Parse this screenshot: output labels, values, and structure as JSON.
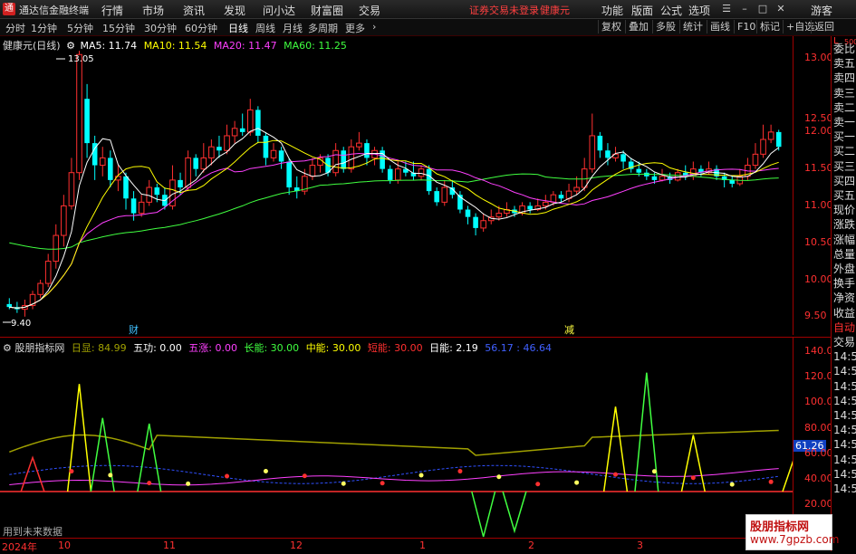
{
  "titlebar": {
    "logo": "通",
    "app_name": "通达信金融终端",
    "menus": [
      "行情",
      "市场",
      "资讯",
      "发现",
      "问小达",
      "财富圈",
      "交易"
    ],
    "warning": "证券交易未登录",
    "stock": "健康元",
    "right_menus": [
      "功能",
      "版面",
      "公式",
      "选项"
    ],
    "guest": "游客"
  },
  "toolbar": {
    "periods": [
      "分时",
      "1分钟",
      "5分钟",
      "15分钟",
      "30分钟",
      "60分钟",
      "日线",
      "周线",
      "月线",
      "多周期",
      "更多"
    ],
    "active_period": "日线",
    "right_buttons": [
      "复权",
      "叠加",
      "多股",
      "统计",
      "画线",
      "F10",
      "标记",
      "+自选",
      "返回"
    ]
  },
  "legend": {
    "title": "健康元(日线)",
    "ma": [
      {
        "label": "MA5: 11.74",
        "color": "#ffffff"
      },
      {
        "label": "MA10: 11.54",
        "color": "#ffff00"
      },
      {
        "label": "MA20: 11.47",
        "color": "#ff40ff"
      },
      {
        "label": "MA60: 11.25",
        "color": "#40ff40"
      }
    ]
  },
  "price_axis": {
    "ticks": [
      "13.00",
      "12.50",
      "12.00",
      "11.50",
      "11.00",
      "10.50",
      "10.00",
      "9.50"
    ],
    "high_label": "13.05",
    "low_label": "9.40"
  },
  "markers": {
    "cai": "财",
    "jian": "减"
  },
  "indicator_legend": {
    "name": "股朋指标网",
    "items": [
      {
        "label": "日显: 84.99",
        "color": "#a0a000"
      },
      {
        "label": "五功: 0.00",
        "color": "#ffffff"
      },
      {
        "label": "五涨: 0.00",
        "color": "#ff40ff"
      },
      {
        "label": "长能: 30.00",
        "color": "#40ff40"
      },
      {
        "label": "中能: 30.00",
        "color": "#ffff00"
      },
      {
        "label": "短能: 30.00",
        "color": "#ff3030"
      },
      {
        "label": "日能: 2.19",
        "color": "#ffffff"
      },
      {
        "label": "56.17 : 46.64",
        "color": "#4060ff"
      }
    ]
  },
  "indicator_axis": {
    "ticks": [
      "140.00",
      "120.00",
      "100.00",
      "80.00",
      "60.00",
      "40.00",
      "20.00"
    ],
    "current": "61.26"
  },
  "indicator_note": "用到未来数据",
  "x_axis": {
    "labels": [
      "2024年",
      "10",
      "11",
      "12",
      "1",
      "2",
      "3"
    ]
  },
  "right_panel": [
    "L",
    "500",
    "委比",
    "卖五",
    "卖四",
    "卖三",
    "卖二",
    "卖一",
    "买一",
    "买二",
    "买三",
    "买四",
    "买五",
    "现价",
    "涨跌",
    "涨幅",
    "总量",
    "外盘",
    "换手",
    "净资",
    "收益",
    "自动",
    "交易",
    "14:56",
    "14:56",
    "14:56",
    "14:56",
    "14:56",
    "14:56",
    "14:56",
    "14:56",
    "14:56",
    "14:56"
  ],
  "watermark": {
    "line1": "股朋指标网",
    "line2": "www.7gpzb.com"
  },
  "colors": {
    "up": "#ff3030",
    "down": "#00ffff",
    "ma5": "#ffffff",
    "ma10": "#ffff00",
    "ma20": "#ff40ff",
    "ma60": "#40ff40",
    "axis": "#a00000"
  },
  "chart_data": {
    "type": "candlestick",
    "ylim": [
      9.3,
      13.15
    ],
    "candles": [
      [
        9.62,
        9.58,
        9.7,
        9.55
      ],
      [
        9.58,
        9.55,
        9.65,
        9.5
      ],
      [
        9.55,
        9.6,
        9.68,
        9.45
      ],
      [
        9.6,
        9.75,
        9.8,
        9.55
      ],
      [
        9.75,
        9.9,
        9.95,
        9.7
      ],
      [
        9.9,
        10.2,
        10.3,
        9.85
      ],
      [
        10.2,
        10.55,
        10.7,
        10.1
      ],
      [
        10.55,
        10.95,
        11.1,
        10.4
      ],
      [
        10.95,
        11.4,
        11.6,
        10.9
      ],
      [
        11.4,
        13.0,
        13.05,
        11.3
      ],
      [
        12.4,
        11.8,
        12.6,
        11.6
      ],
      [
        11.8,
        11.5,
        11.9,
        11.3
      ],
      [
        11.5,
        11.6,
        11.75,
        11.35
      ],
      [
        11.6,
        11.3,
        11.7,
        11.2
      ],
      [
        11.3,
        11.35,
        11.5,
        11.15
      ],
      [
        11.35,
        11.05,
        11.4,
        10.9
      ],
      [
        11.05,
        10.85,
        11.15,
        10.75
      ],
      [
        10.85,
        11.0,
        11.1,
        10.8
      ],
      [
        11.0,
        11.2,
        11.3,
        10.95
      ],
      [
        11.2,
        11.1,
        11.25,
        11.0
      ],
      [
        11.1,
        10.95,
        11.2,
        10.9
      ],
      [
        10.95,
        11.3,
        11.5,
        10.9
      ],
      [
        11.3,
        11.2,
        11.4,
        11.1
      ],
      [
        11.2,
        11.6,
        11.7,
        11.15
      ],
      [
        11.6,
        11.45,
        11.65,
        11.35
      ],
      [
        11.45,
        11.6,
        11.8,
        11.4
      ],
      [
        11.6,
        11.75,
        11.85,
        11.5
      ],
      [
        11.75,
        11.7,
        11.9,
        11.6
      ],
      [
        11.7,
        11.9,
        12.05,
        11.65
      ],
      [
        11.9,
        12.0,
        12.1,
        11.8
      ],
      [
        12.0,
        11.95,
        12.2,
        11.9
      ],
      [
        11.95,
        12.25,
        12.4,
        11.9
      ],
      [
        12.25,
        11.9,
        12.3,
        11.8
      ],
      [
        11.9,
        11.6,
        11.95,
        11.5
      ],
      [
        11.6,
        11.7,
        11.8,
        11.55
      ],
      [
        11.7,
        11.55,
        11.75,
        11.45
      ],
      [
        11.55,
        11.2,
        11.6,
        11.1
      ],
      [
        11.2,
        11.15,
        11.35,
        11.05
      ],
      [
        11.15,
        11.35,
        11.45,
        11.1
      ],
      [
        11.35,
        11.5,
        11.6,
        11.3
      ],
      [
        11.5,
        11.6,
        11.65,
        11.4
      ],
      [
        11.6,
        11.4,
        11.65,
        11.35
      ],
      [
        11.4,
        11.7,
        11.8,
        11.35
      ],
      [
        11.7,
        11.45,
        11.75,
        11.4
      ],
      [
        11.45,
        11.75,
        11.85,
        11.4
      ],
      [
        11.75,
        11.8,
        11.95,
        11.7
      ],
      [
        11.8,
        11.6,
        11.85,
        11.5
      ],
      [
        11.6,
        11.7,
        11.75,
        11.5
      ],
      [
        11.7,
        11.45,
        11.75,
        11.4
      ],
      [
        11.45,
        11.3,
        11.5,
        11.25
      ],
      [
        11.3,
        11.45,
        11.55,
        11.25
      ],
      [
        11.45,
        11.4,
        11.55,
        11.35
      ],
      [
        11.4,
        11.35,
        11.55,
        11.3
      ],
      [
        11.35,
        11.45,
        11.5,
        11.3
      ],
      [
        11.45,
        11.15,
        11.5,
        11.1
      ],
      [
        11.15,
        11.0,
        11.2,
        10.95
      ],
      [
        11.0,
        11.2,
        11.3,
        10.95
      ],
      [
        11.2,
        11.1,
        11.3,
        11.05
      ],
      [
        11.1,
        10.9,
        11.15,
        10.85
      ],
      [
        10.9,
        10.8,
        10.95,
        10.7
      ],
      [
        10.8,
        10.65,
        10.85,
        10.55
      ],
      [
        10.65,
        10.75,
        10.85,
        10.6
      ],
      [
        10.75,
        10.8,
        10.9,
        10.7
      ],
      [
        10.8,
        10.85,
        10.95,
        10.75
      ],
      [
        10.85,
        10.9,
        11.0,
        10.8
      ],
      [
        10.9,
        10.85,
        10.95,
        10.8
      ],
      [
        10.85,
        10.95,
        11.0,
        10.82
      ],
      [
        10.95,
        10.9,
        11.0,
        10.85
      ],
      [
        10.9,
        10.95,
        11.05,
        10.88
      ],
      [
        10.95,
        11.0,
        11.1,
        10.9
      ],
      [
        11.0,
        11.1,
        11.15,
        10.95
      ],
      [
        11.1,
        11.05,
        11.15,
        11.0
      ],
      [
        11.05,
        11.15,
        11.25,
        11.0
      ],
      [
        11.15,
        11.2,
        11.35,
        11.1
      ],
      [
        11.2,
        11.45,
        11.6,
        11.15
      ],
      [
        11.45,
        11.9,
        12.2,
        11.4
      ],
      [
        11.9,
        11.7,
        11.95,
        11.6
      ],
      [
        11.7,
        11.6,
        11.8,
        11.5
      ],
      [
        11.6,
        11.65,
        11.75,
        11.55
      ],
      [
        11.65,
        11.55,
        11.7,
        11.45
      ],
      [
        11.55,
        11.45,
        11.6,
        11.4
      ],
      [
        11.45,
        11.4,
        11.55,
        11.35
      ],
      [
        11.4,
        11.35,
        11.45,
        11.3
      ],
      [
        11.35,
        11.3,
        11.4,
        11.25
      ],
      [
        11.3,
        11.35,
        11.45,
        11.28
      ],
      [
        11.35,
        11.3,
        11.4,
        11.25
      ],
      [
        11.3,
        11.4,
        11.45,
        11.28
      ],
      [
        11.4,
        11.35,
        11.5,
        11.3
      ],
      [
        11.35,
        11.45,
        11.55,
        11.3
      ],
      [
        11.45,
        11.4,
        11.5,
        11.35
      ],
      [
        11.4,
        11.45,
        11.55,
        11.38
      ],
      [
        11.45,
        11.35,
        11.5,
        11.3
      ],
      [
        11.35,
        11.3,
        11.4,
        11.2
      ],
      [
        11.3,
        11.25,
        11.35,
        11.2
      ],
      [
        11.25,
        11.35,
        11.45,
        11.22
      ],
      [
        11.35,
        11.5,
        11.6,
        11.3
      ],
      [
        11.5,
        11.65,
        11.8,
        11.45
      ],
      [
        11.65,
        11.85,
        12.05,
        11.6
      ],
      [
        11.85,
        11.95,
        12.05,
        11.8
      ],
      [
        11.95,
        11.75,
        11.98,
        11.7
      ]
    ]
  }
}
